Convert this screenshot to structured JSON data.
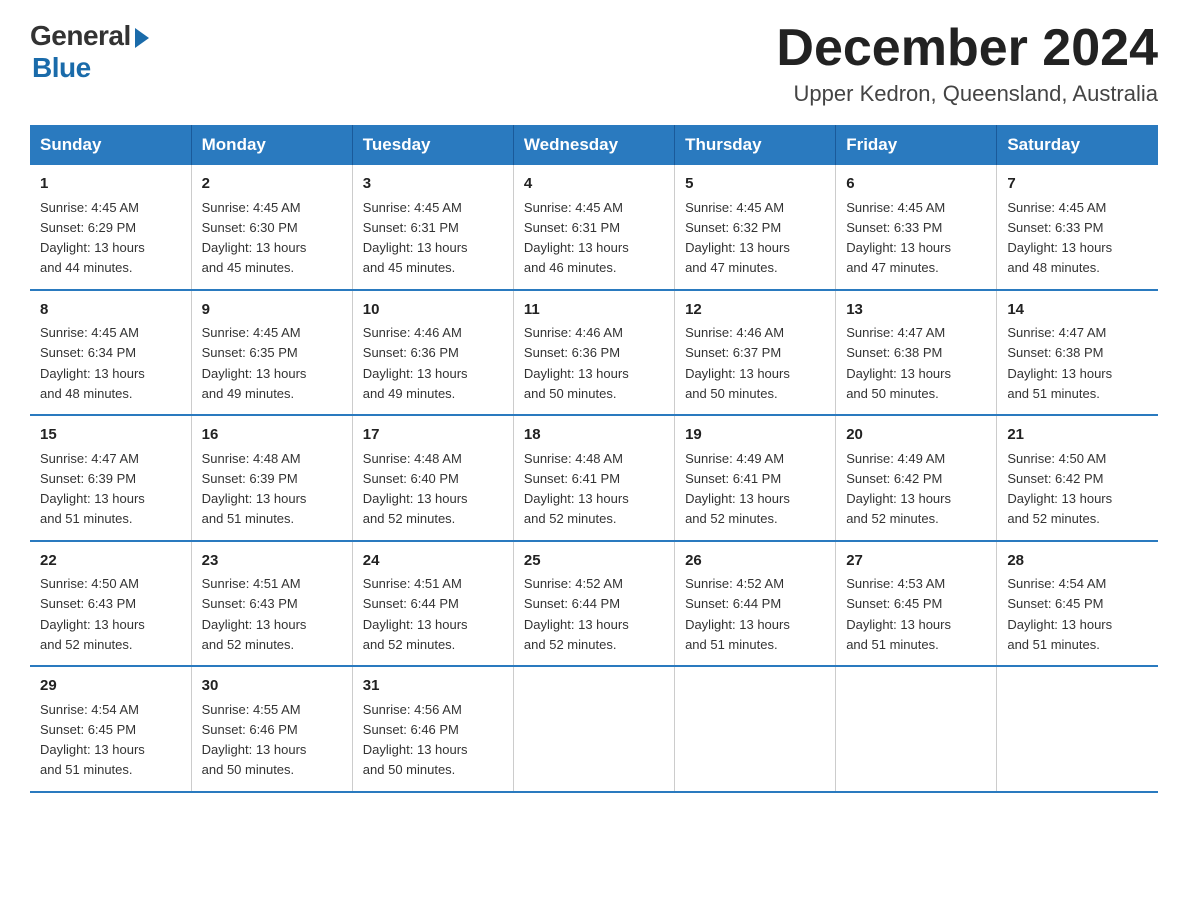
{
  "logo": {
    "general": "General",
    "blue": "Blue"
  },
  "title": "December 2024",
  "subtitle": "Upper Kedron, Queensland, Australia",
  "days_of_week": [
    "Sunday",
    "Monday",
    "Tuesday",
    "Wednesday",
    "Thursday",
    "Friday",
    "Saturday"
  ],
  "weeks": [
    [
      {
        "day": "1",
        "sunrise": "4:45 AM",
        "sunset": "6:29 PM",
        "daylight": "13 hours and 44 minutes."
      },
      {
        "day": "2",
        "sunrise": "4:45 AM",
        "sunset": "6:30 PM",
        "daylight": "13 hours and 45 minutes."
      },
      {
        "day": "3",
        "sunrise": "4:45 AM",
        "sunset": "6:31 PM",
        "daylight": "13 hours and 45 minutes."
      },
      {
        "day": "4",
        "sunrise": "4:45 AM",
        "sunset": "6:31 PM",
        "daylight": "13 hours and 46 minutes."
      },
      {
        "day": "5",
        "sunrise": "4:45 AM",
        "sunset": "6:32 PM",
        "daylight": "13 hours and 47 minutes."
      },
      {
        "day": "6",
        "sunrise": "4:45 AM",
        "sunset": "6:33 PM",
        "daylight": "13 hours and 47 minutes."
      },
      {
        "day": "7",
        "sunrise": "4:45 AM",
        "sunset": "6:33 PM",
        "daylight": "13 hours and 48 minutes."
      }
    ],
    [
      {
        "day": "8",
        "sunrise": "4:45 AM",
        "sunset": "6:34 PM",
        "daylight": "13 hours and 48 minutes."
      },
      {
        "day": "9",
        "sunrise": "4:45 AM",
        "sunset": "6:35 PM",
        "daylight": "13 hours and 49 minutes."
      },
      {
        "day": "10",
        "sunrise": "4:46 AM",
        "sunset": "6:36 PM",
        "daylight": "13 hours and 49 minutes."
      },
      {
        "day": "11",
        "sunrise": "4:46 AM",
        "sunset": "6:36 PM",
        "daylight": "13 hours and 50 minutes."
      },
      {
        "day": "12",
        "sunrise": "4:46 AM",
        "sunset": "6:37 PM",
        "daylight": "13 hours and 50 minutes."
      },
      {
        "day": "13",
        "sunrise": "4:47 AM",
        "sunset": "6:38 PM",
        "daylight": "13 hours and 50 minutes."
      },
      {
        "day": "14",
        "sunrise": "4:47 AM",
        "sunset": "6:38 PM",
        "daylight": "13 hours and 51 minutes."
      }
    ],
    [
      {
        "day": "15",
        "sunrise": "4:47 AM",
        "sunset": "6:39 PM",
        "daylight": "13 hours and 51 minutes."
      },
      {
        "day": "16",
        "sunrise": "4:48 AM",
        "sunset": "6:39 PM",
        "daylight": "13 hours and 51 minutes."
      },
      {
        "day": "17",
        "sunrise": "4:48 AM",
        "sunset": "6:40 PM",
        "daylight": "13 hours and 52 minutes."
      },
      {
        "day": "18",
        "sunrise": "4:48 AM",
        "sunset": "6:41 PM",
        "daylight": "13 hours and 52 minutes."
      },
      {
        "day": "19",
        "sunrise": "4:49 AM",
        "sunset": "6:41 PM",
        "daylight": "13 hours and 52 minutes."
      },
      {
        "day": "20",
        "sunrise": "4:49 AM",
        "sunset": "6:42 PM",
        "daylight": "13 hours and 52 minutes."
      },
      {
        "day": "21",
        "sunrise": "4:50 AM",
        "sunset": "6:42 PM",
        "daylight": "13 hours and 52 minutes."
      }
    ],
    [
      {
        "day": "22",
        "sunrise": "4:50 AM",
        "sunset": "6:43 PM",
        "daylight": "13 hours and 52 minutes."
      },
      {
        "day": "23",
        "sunrise": "4:51 AM",
        "sunset": "6:43 PM",
        "daylight": "13 hours and 52 minutes."
      },
      {
        "day": "24",
        "sunrise": "4:51 AM",
        "sunset": "6:44 PM",
        "daylight": "13 hours and 52 minutes."
      },
      {
        "day": "25",
        "sunrise": "4:52 AM",
        "sunset": "6:44 PM",
        "daylight": "13 hours and 52 minutes."
      },
      {
        "day": "26",
        "sunrise": "4:52 AM",
        "sunset": "6:44 PM",
        "daylight": "13 hours and 51 minutes."
      },
      {
        "day": "27",
        "sunrise": "4:53 AM",
        "sunset": "6:45 PM",
        "daylight": "13 hours and 51 minutes."
      },
      {
        "day": "28",
        "sunrise": "4:54 AM",
        "sunset": "6:45 PM",
        "daylight": "13 hours and 51 minutes."
      }
    ],
    [
      {
        "day": "29",
        "sunrise": "4:54 AM",
        "sunset": "6:45 PM",
        "daylight": "13 hours and 51 minutes."
      },
      {
        "day": "30",
        "sunrise": "4:55 AM",
        "sunset": "6:46 PM",
        "daylight": "13 hours and 50 minutes."
      },
      {
        "day": "31",
        "sunrise": "4:56 AM",
        "sunset": "6:46 PM",
        "daylight": "13 hours and 50 minutes."
      },
      null,
      null,
      null,
      null
    ]
  ],
  "labels": {
    "sunrise": "Sunrise:",
    "sunset": "Sunset:",
    "daylight": "Daylight:"
  }
}
